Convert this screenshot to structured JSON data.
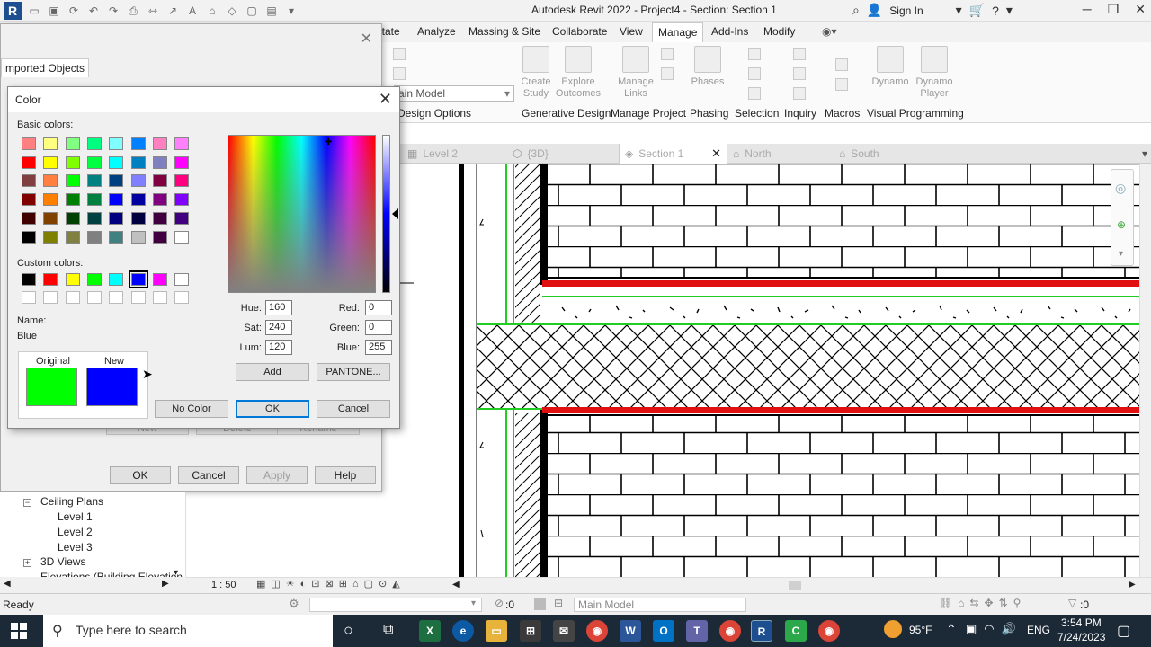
{
  "titlebar": {
    "app_title": "Autodesk Revit 2022 - Project4 - Section: Section 1",
    "sign_in": "Sign In",
    "help": "?"
  },
  "ribbon": {
    "tabs": [
      {
        "label": "otate"
      },
      {
        "label": "Analyze"
      },
      {
        "label": "Massing & Site"
      },
      {
        "label": "Collaborate"
      },
      {
        "label": "View"
      },
      {
        "label": "Manage",
        "active": true
      },
      {
        "label": "Add-Ins"
      },
      {
        "label": "Modify"
      }
    ],
    "buttons": [
      {
        "label": "Create Study"
      },
      {
        "label": "Explore Outcomes"
      },
      {
        "label": "Manage Links"
      },
      {
        "label": "Phases"
      },
      {
        "label": "Dynamo"
      },
      {
        "label": "Dynamo Player"
      }
    ],
    "panels": [
      {
        "label": "Design Options"
      },
      {
        "label": "Generative Design"
      },
      {
        "label": "Manage Project"
      },
      {
        "label": "Phasing"
      },
      {
        "label": "Selection"
      },
      {
        "label": "Inquiry"
      },
      {
        "label": "Macros"
      },
      {
        "label": "Visual Programming"
      }
    ],
    "design_option_select": "ain Model"
  },
  "view_tabs": [
    {
      "label": "Level 2"
    },
    {
      "label": "{3D}"
    },
    {
      "label": "Section 1",
      "active": true
    },
    {
      "label": "North"
    },
    {
      "label": "South"
    }
  ],
  "bg_dialog": {
    "tab": "mported Objects",
    "buttons": {
      "ok": "OK",
      "cancel": "Cancel",
      "apply": "Apply",
      "help": "Help"
    },
    "ghost_buttons": [
      "New",
      "Delete",
      "Rename"
    ]
  },
  "color_dialog": {
    "title": "Color",
    "basic_colors_label": "Basic colors:",
    "custom_colors_label": "Custom colors:",
    "basic_colors": [
      "#ff8080",
      "#ffff80",
      "#80ff80",
      "#00ff80",
      "#80ffff",
      "#0080ff",
      "#ff80c0",
      "#ff80ff",
      "#ff0000",
      "#ffff00",
      "#80ff00",
      "#00ff40",
      "#00ffff",
      "#0080c0",
      "#8080c0",
      "#ff00ff",
      "#804040",
      "#ff8040",
      "#00ff00",
      "#008080",
      "#004080",
      "#8080ff",
      "#800040",
      "#ff0080",
      "#800000",
      "#ff8000",
      "#008000",
      "#008040",
      "#0000ff",
      "#0000a0",
      "#800080",
      "#8000ff",
      "#400000",
      "#804000",
      "#004000",
      "#004040",
      "#000080",
      "#000040",
      "#400040",
      "#400080",
      "#000000",
      "#808000",
      "#808040",
      "#808080",
      "#408080",
      "#c0c0c0",
      "#400040",
      "#ffffff"
    ],
    "custom_colors": [
      "#000000",
      "#ff0000",
      "#ffff00",
      "#00ff00",
      "#00ffff",
      "#0000ff",
      "#ff00ff",
      "#ffffff",
      "#ffffff",
      "#ffffff",
      "#ffffff",
      "#ffffff",
      "#ffffff",
      "#ffffff",
      "#ffffff",
      "#ffffff"
    ],
    "name_label": "Name:",
    "name_value": "Blue",
    "original_label": "Original",
    "new_label": "New",
    "original_color": "#00ff00",
    "new_color": "#0000ff",
    "fields": {
      "hue_label": "Hue:",
      "hue": "160",
      "sat_label": "Sat:",
      "sat": "240",
      "lum_label": "Lum:",
      "lum": "120",
      "red_label": "Red:",
      "red": "0",
      "green_label": "Green:",
      "green": "0",
      "blue_label": "Blue:",
      "blue": "255"
    },
    "buttons": {
      "add": "Add",
      "pantone": "PANTONE...",
      "no_color": "No Color",
      "ok": "OK",
      "cancel": "Cancel"
    }
  },
  "browser": {
    "items": [
      {
        "label": "Ceiling Plans"
      },
      {
        "label": "Level 1"
      },
      {
        "label": "Level 2"
      },
      {
        "label": "Level 3"
      },
      {
        "label": "3D Views"
      },
      {
        "label": "Elevations (Building Elevation"
      }
    ]
  },
  "viewbar": {
    "scale": "1 : 50"
  },
  "statusbar": {
    "status": "Ready",
    "count_left": ":0",
    "model": "Main Model",
    "count_right": ":0"
  },
  "taskbar": {
    "search_placeholder": "Type here to search",
    "weather": "95°F",
    "lang": "ENG",
    "time": "3:54 PM",
    "date": "7/24/2023"
  },
  "colors": {
    "accent_red": "#e01010",
    "green_lines": "#22cc22",
    "default_button_border": "#0078d7"
  }
}
